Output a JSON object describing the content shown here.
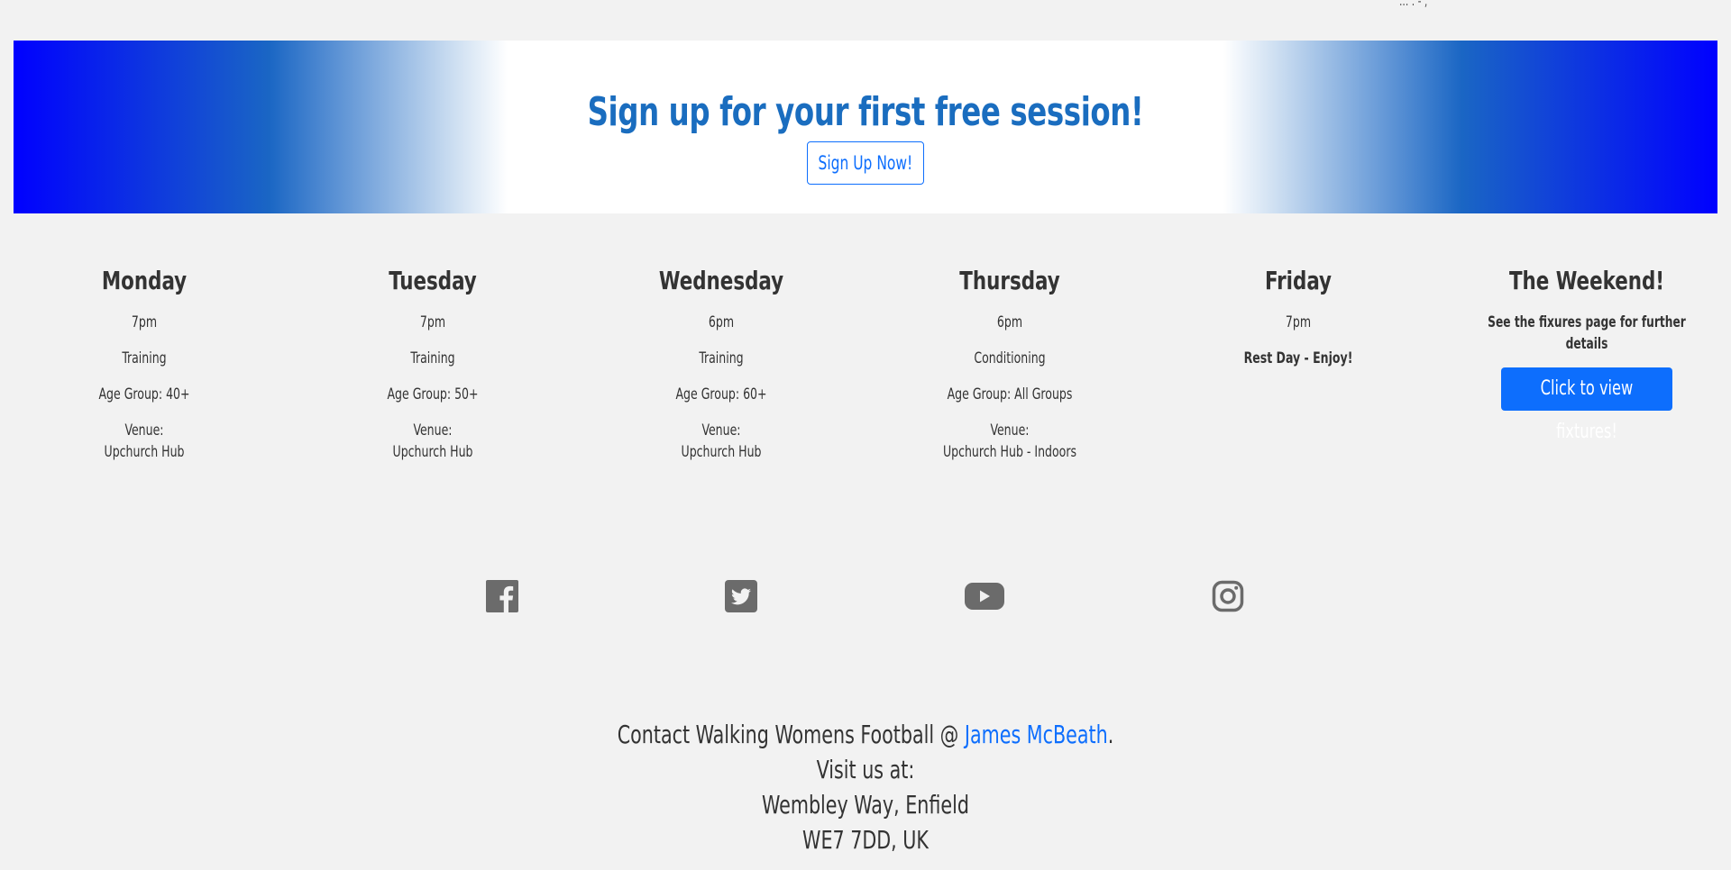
{
  "top_remnant": "... . - ,",
  "banner": {
    "title": "Sign up for your first free session!",
    "button_label": "Sign Up Now!"
  },
  "schedule": [
    {
      "day": "Monday",
      "time": "7pm",
      "activity": "Training",
      "age_group": "Age Group: 40+",
      "venue_label": "Venue:",
      "venue": "Upchurch Hub"
    },
    {
      "day": "Tuesday",
      "time": "7pm",
      "activity": "Training",
      "age_group": "Age Group: 50+",
      "venue_label": "Venue:",
      "venue": "Upchurch Hub"
    },
    {
      "day": "Wednesday",
      "time": "6pm",
      "activity": "Training",
      "age_group": "Age Group: 60+",
      "venue_label": "Venue:",
      "venue": "Upchurch Hub"
    },
    {
      "day": "Thursday",
      "time": "6pm",
      "activity": "Conditioning",
      "age_group": "Age Group: All Groups",
      "venue_label": "Venue:",
      "venue": "Upchurch Hub - Indoors"
    },
    {
      "day": "Friday",
      "time": "7pm",
      "note": "Rest Day - Enjoy!"
    }
  ],
  "weekend": {
    "day": "The Weekend!",
    "note": "See the fixures page for further details",
    "button_label": "Click to view fixtures!"
  },
  "socials": [
    {
      "icon": "facebook-icon"
    },
    {
      "icon": "twitter-icon"
    },
    {
      "icon": "youtube-icon"
    },
    {
      "icon": "instagram-icon"
    }
  ],
  "contact": {
    "prefix": "Contact Walking Womens Football @ ",
    "link_text": "James McBeath",
    "suffix": ".",
    "visit": "Visit us at:",
    "address_line1": "Wembley Way, Enfield",
    "address_line2": "WE7 7DD, UK"
  },
  "colors": {
    "background": "#f2f2f2",
    "accent": "#0d6efd",
    "banner_title": "#1a6dbf",
    "banner_edge": "#0000ff",
    "icon_grey": "#6b6b6b"
  }
}
